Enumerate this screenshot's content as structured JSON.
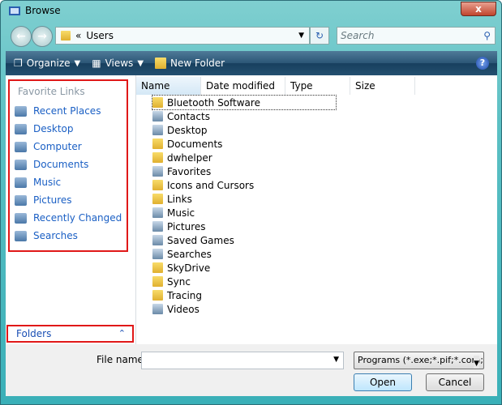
{
  "window": {
    "title": "Browse",
    "close": "x"
  },
  "nav": {
    "back": "←",
    "forward": "→",
    "path_prefix": "«",
    "path": "Users",
    "refresh": "↻",
    "search_placeholder": "Search"
  },
  "toolbar": {
    "organize": "Organize",
    "views": "Views",
    "new_folder": "New Folder",
    "help": "?"
  },
  "sidebar": {
    "header": "Favorite Links",
    "items": [
      {
        "label": "Recent Places"
      },
      {
        "label": "Desktop"
      },
      {
        "label": "Computer"
      },
      {
        "label": "Documents"
      },
      {
        "label": "Music"
      },
      {
        "label": "Pictures"
      },
      {
        "label": "Recently Changed"
      },
      {
        "label": "Searches"
      }
    ],
    "folders": "Folders",
    "folders_chevron": "⌃"
  },
  "columns": [
    "Name",
    "Date modified",
    "Type",
    "Size"
  ],
  "files": [
    "Bluetooth Software",
    "Contacts",
    "Desktop",
    "Documents",
    "dwhelper",
    "Favorites",
    "Icons and Cursors",
    "Links",
    "Music",
    "Pictures",
    "Saved Games",
    "Searches",
    "SkyDrive",
    "Sync",
    "Tracing",
    "Videos"
  ],
  "bottom": {
    "file_name_label": "File name:",
    "file_name_value": "",
    "file_type": "Programs (*.exe;*.pif;*.com;*.",
    "open": "Open",
    "cancel": "Cancel"
  }
}
